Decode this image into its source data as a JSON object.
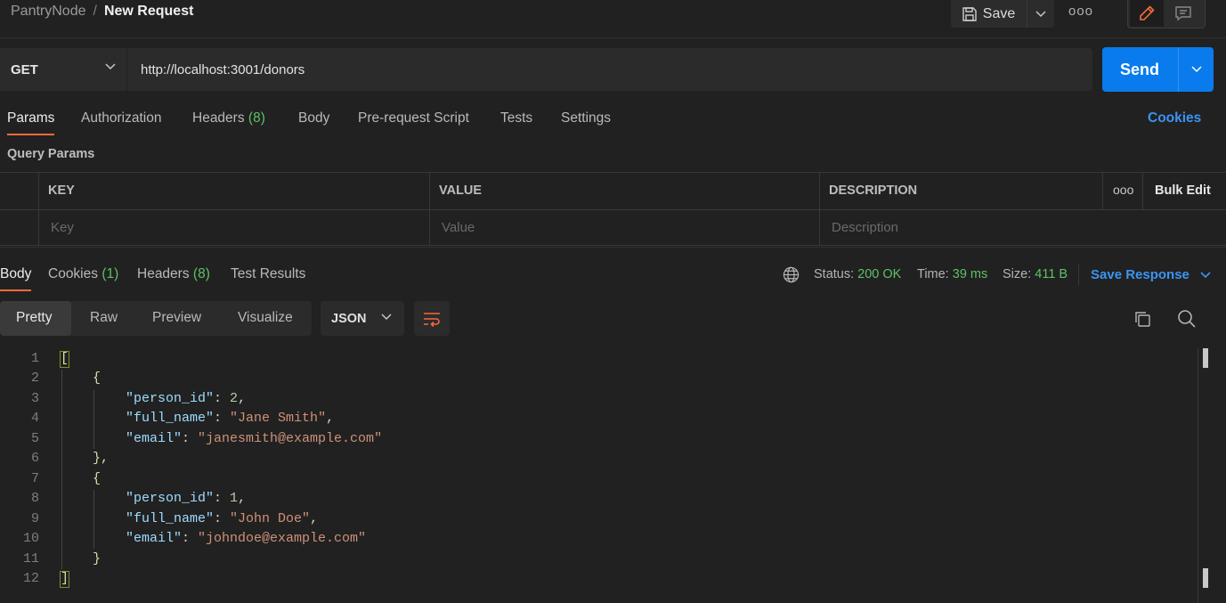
{
  "breadcrumb": {
    "workspace": "PantryNode",
    "separator": "/",
    "current": "New Request"
  },
  "header": {
    "save_label": "Save",
    "more_label": "ooo"
  },
  "request": {
    "method": "GET",
    "url": "http://localhost:3001/donors",
    "send_label": "Send"
  },
  "request_tabs": {
    "params": "Params",
    "authorization": "Authorization",
    "headers": "Headers",
    "headers_count": "(8)",
    "body": "Body",
    "pre_request_script": "Pre-request Script",
    "tests": "Tests",
    "settings": "Settings",
    "cookies": "Cookies"
  },
  "query_params": {
    "title": "Query Params",
    "columns": {
      "key": "KEY",
      "value": "VALUE",
      "description": "DESCRIPTION"
    },
    "more_label": "ooo",
    "bulk_edit": "Bulk Edit",
    "placeholders": {
      "key": "Key",
      "value": "Value",
      "description": "Description"
    }
  },
  "response_tabs": {
    "body": "Body",
    "cookies": "Cookies",
    "cookies_count": "(1)",
    "headers": "Headers",
    "headers_count": "(8)",
    "test_results": "Test Results"
  },
  "response_status": {
    "status_label": "Status:",
    "status_value": "200 OK",
    "time_label": "Time:",
    "time_value": "39 ms",
    "size_label": "Size:",
    "size_value": "411 B",
    "save_response": "Save Response"
  },
  "view": {
    "pretty": "Pretty",
    "raw": "Raw",
    "preview": "Preview",
    "visualize": "Visualize",
    "format": "JSON"
  },
  "code": {
    "line_numbers": [
      "1",
      "2",
      "3",
      "4",
      "5",
      "6",
      "7",
      "8",
      "9",
      "10",
      "11",
      "12"
    ],
    "open_array": "[",
    "close_array": "]",
    "open_obj": "{",
    "close_obj_comma": "},",
    "close_obj": "}",
    "records": [
      {
        "id_key": "\"person_id\"",
        "id_value": "2",
        "name_key": "\"full_name\"",
        "name_value": "\"Jane Smith\"",
        "email_key": "\"email\"",
        "email_value": "\"janesmith@example.com\""
      },
      {
        "id_key": "\"person_id\"",
        "id_value": "1",
        "name_key": "\"full_name\"",
        "name_value": "\"John Doe\"",
        "email_key": "\"email\"",
        "email_value": "\"johndoe@example.com\""
      }
    ]
  },
  "colors": {
    "accent_orange": "#f26b3a",
    "send_blue": "#097bed",
    "link_blue": "#3b94f2",
    "success_green": "#5dc164"
  },
  "icons": [
    "save-icon",
    "chevron-down-icon",
    "more-icon",
    "pencil-icon",
    "comment-icon",
    "globe-icon",
    "wrap-lines-icon",
    "copy-icon",
    "search-icon"
  ]
}
